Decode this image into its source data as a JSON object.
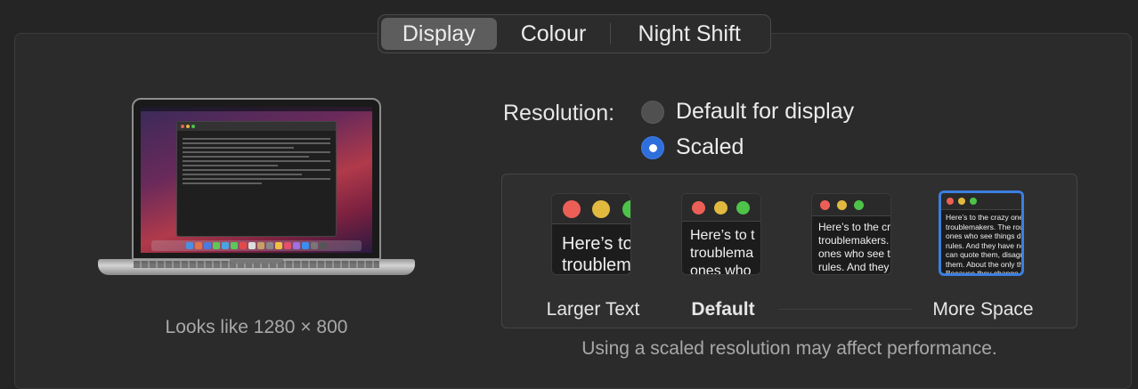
{
  "tabs": [
    {
      "label": "Display",
      "active": true
    },
    {
      "label": "Colour",
      "active": false
    },
    {
      "label": "Night Shift",
      "active": false
    }
  ],
  "display": {
    "looks_like": "Looks like 1280 × 800"
  },
  "resolution": {
    "label": "Resolution:",
    "options": [
      {
        "label": "Default for display",
        "selected": false
      },
      {
        "label": "Scaled",
        "selected": true
      }
    ]
  },
  "scaling": {
    "options": [
      {
        "label": "Larger Text",
        "preview_lines": [
          "Here’s to",
          "troublem"
        ],
        "selected": false
      },
      {
        "label": "Default",
        "preview_lines": [
          "Here’s to t",
          "troublema",
          "ones who"
        ],
        "selected": false
      },
      {
        "label": "",
        "preview_lines": [
          "Here’s to the cr",
          "troublemakers.",
          "ones who see t",
          "rules. And they"
        ],
        "selected": false
      },
      {
        "label": "More Space",
        "preview_lines": [
          "Here’s to the crazy ones",
          "troublemakers. The rou",
          "ones who see things diff",
          "rules. And they have no",
          "can quote them, disagr",
          "them. About the only th",
          "Because they change th"
        ],
        "selected": true
      }
    ],
    "note": "Using a scaled resolution may affect performance."
  },
  "colors": {
    "accent": "#2f6fdc",
    "traffic_red": "#ec5f57",
    "traffic_yellow": "#e1b93f",
    "traffic_green": "#4ec34a"
  }
}
